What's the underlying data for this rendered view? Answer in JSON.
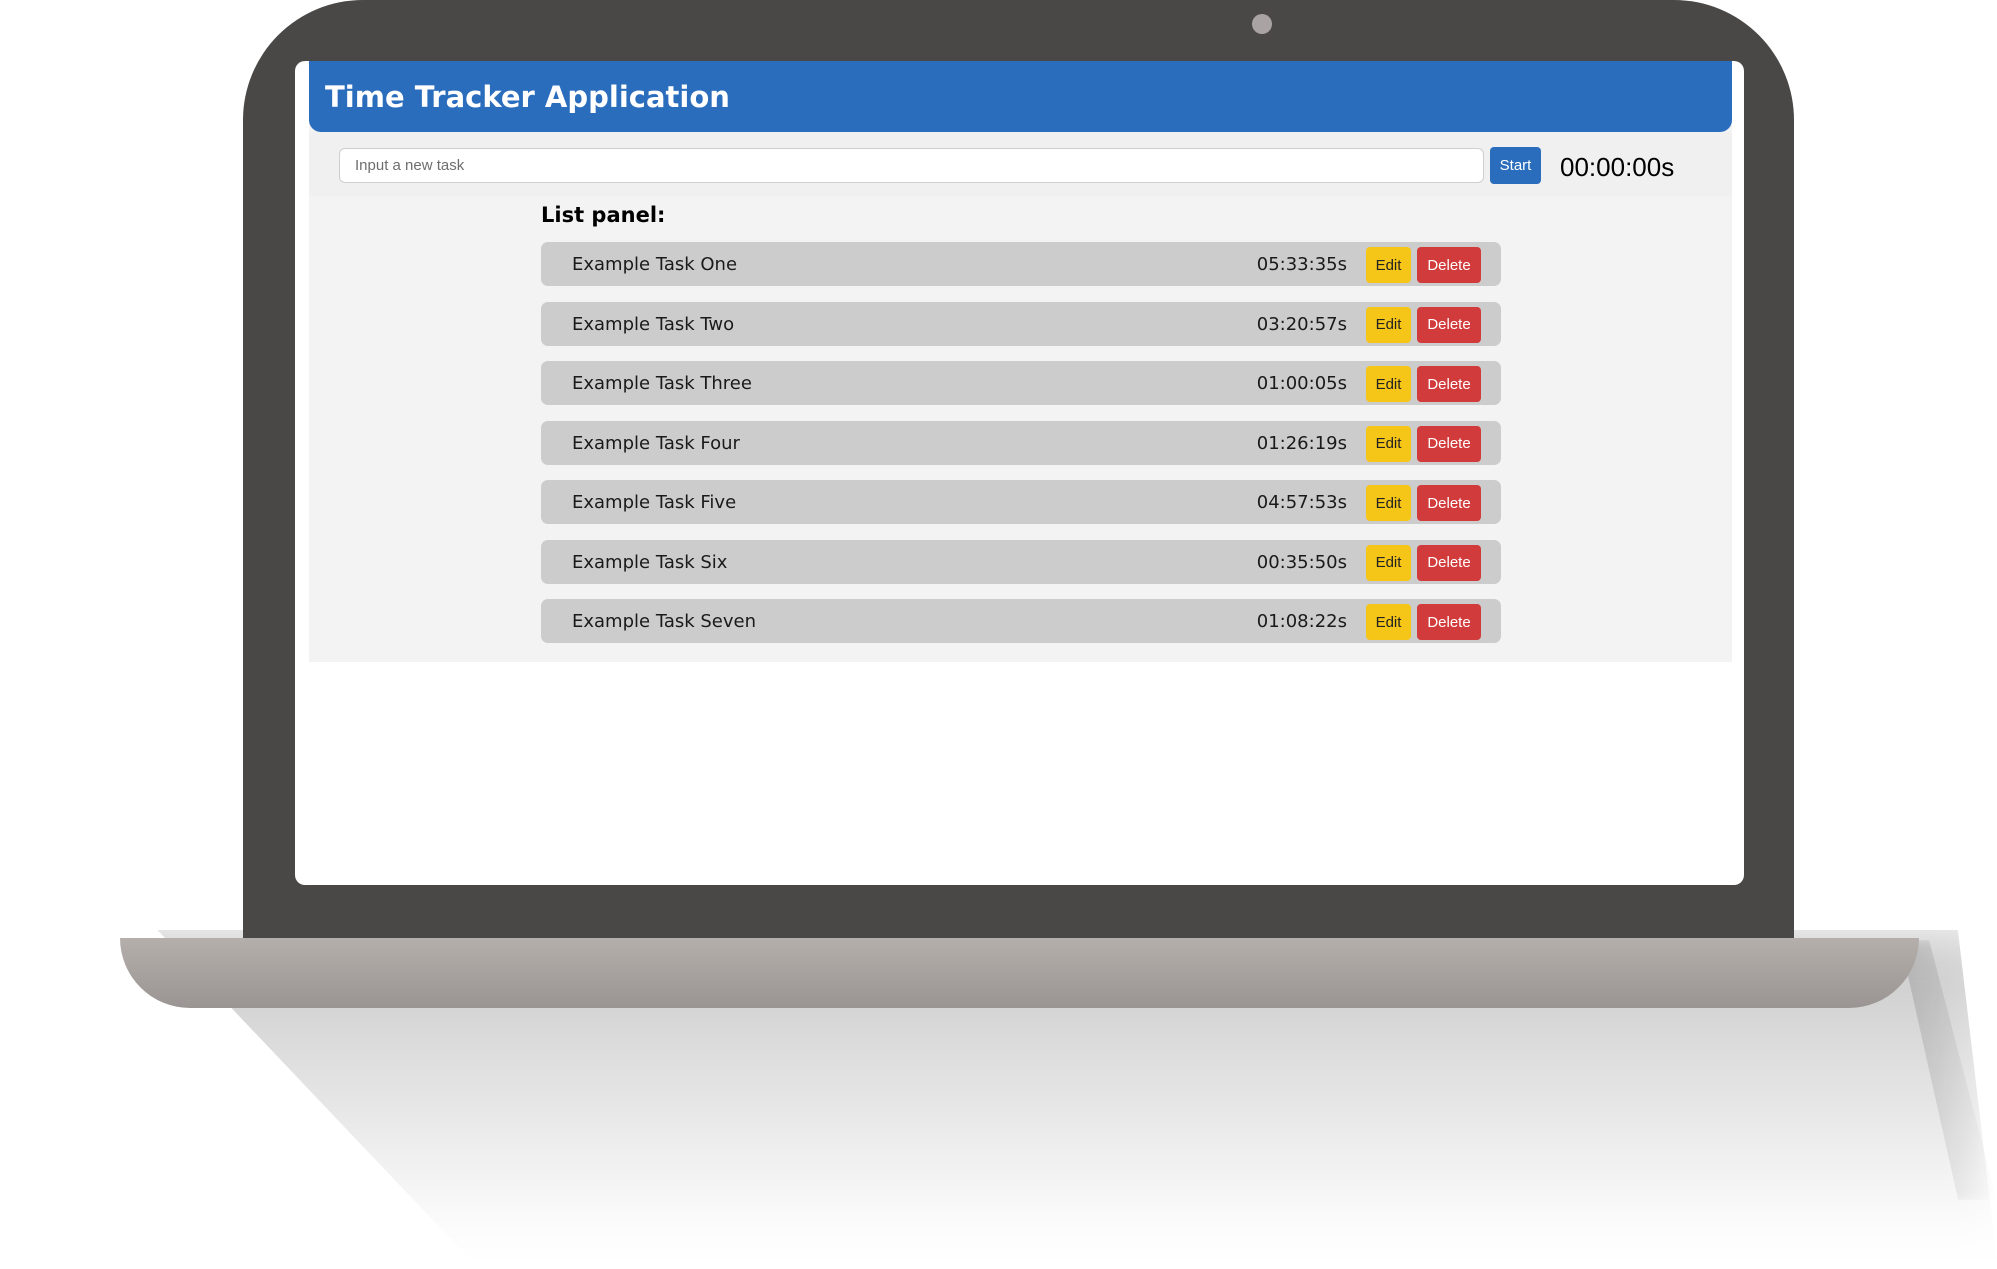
{
  "header": {
    "title": "Time Tracker Application"
  },
  "task_bar": {
    "input_placeholder": "Input a new task",
    "input_value": "",
    "start_label": "Start",
    "timer": "00:00:00s"
  },
  "list_panel": {
    "title": "List panel:",
    "tasks": [
      {
        "name": "Example Task One",
        "time": "05:33:35s",
        "edit_label": "Edit",
        "delete_label": "Delete"
      },
      {
        "name": "Example Task Two",
        "time": "03:20:57s",
        "edit_label": "Edit",
        "delete_label": "Delete"
      },
      {
        "name": "Example Task Three",
        "time": "01:00:05s",
        "edit_label": "Edit",
        "delete_label": "Delete"
      },
      {
        "name": "Example Task Four",
        "time": "01:26:19s",
        "edit_label": "Edit",
        "delete_label": "Delete"
      },
      {
        "name": "Example Task Five",
        "time": "04:57:53s",
        "edit_label": "Edit",
        "delete_label": "Delete"
      },
      {
        "name": "Example Task Six",
        "time": "00:35:50s",
        "edit_label": "Edit",
        "delete_label": "Delete"
      },
      {
        "name": "Example Task Seven",
        "time": "01:08:22s",
        "edit_label": "Edit",
        "delete_label": "Delete"
      }
    ]
  },
  "colors": {
    "header_blue": "#2a6dbd",
    "edit_yellow": "#f5c518",
    "delete_red": "#d23b3b",
    "row_gray": "#cccccc",
    "laptop_body": "#4a4847"
  }
}
